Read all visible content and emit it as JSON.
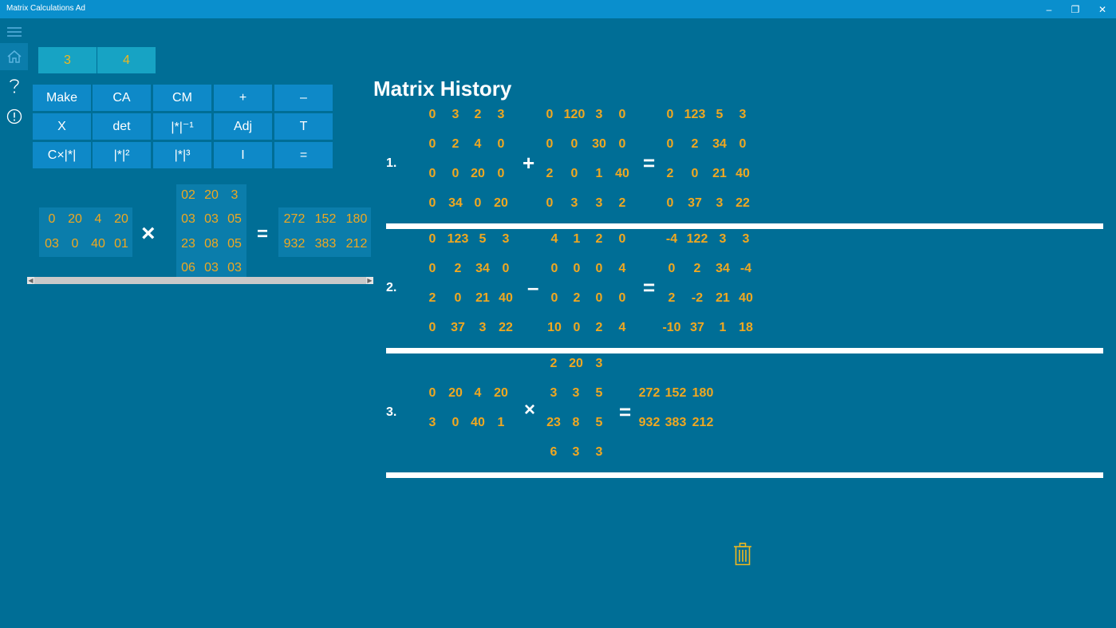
{
  "window": {
    "title": "Matrix Calculations Ad",
    "controls": [
      "–",
      "❐",
      "✕"
    ]
  },
  "sidebar": {
    "icons": [
      "hamburger-icon",
      "home-icon",
      "help-icon",
      "info-icon"
    ]
  },
  "dimensions": {
    "rows": "3",
    "cols": "4"
  },
  "keypad": [
    [
      "Make",
      "CA",
      "CM",
      "+",
      "–"
    ],
    [
      "X",
      "det",
      "|*|⁻¹",
      "Adj",
      "T"
    ],
    [
      "C×|*|",
      "|*|²",
      "|*|³",
      "I",
      "="
    ]
  ],
  "editor": {
    "matrix_a": [
      [
        "0",
        "20",
        "4",
        "20"
      ],
      [
        "03",
        "0",
        "40",
        "01"
      ]
    ],
    "operator": "×",
    "matrix_b": [
      [
        "02",
        "20",
        "3"
      ],
      [
        "03",
        "03",
        "05"
      ],
      [
        "23",
        "08",
        "05"
      ],
      [
        "06",
        "03",
        "03"
      ]
    ],
    "equals": "=",
    "result": [
      [
        "272",
        "152",
        "180"
      ],
      [
        "932",
        "383",
        "212"
      ]
    ]
  },
  "history": {
    "title": "Matrix History",
    "entries": [
      {
        "number": "1.",
        "a": [
          [
            "0",
            "3",
            "2",
            "3"
          ],
          [
            "0",
            "2",
            "4",
            "0"
          ],
          [
            "0",
            "0",
            "20",
            "0"
          ],
          [
            "0",
            "34",
            "0",
            "20"
          ]
        ],
        "op": "+",
        "b": [
          [
            "0",
            "120",
            "3",
            "0"
          ],
          [
            "0",
            "0",
            "30",
            "0"
          ],
          [
            "2",
            "0",
            "1",
            "40"
          ],
          [
            "0",
            "3",
            "3",
            "2"
          ]
        ],
        "eq": "=",
        "r": [
          [
            "0",
            "123",
            "5",
            "3"
          ],
          [
            "0",
            "2",
            "34",
            "0"
          ],
          [
            "2",
            "0",
            "21",
            "40"
          ],
          [
            "0",
            "37",
            "3",
            "22"
          ]
        ]
      },
      {
        "number": "2.",
        "a": [
          [
            "0",
            "123",
            "5",
            "3"
          ],
          [
            "0",
            "2",
            "34",
            "0"
          ],
          [
            "2",
            "0",
            "21",
            "40"
          ],
          [
            "0",
            "37",
            "3",
            "22"
          ]
        ],
        "op": "–",
        "b": [
          [
            "4",
            "1",
            "2",
            "0"
          ],
          [
            "0",
            "0",
            "0",
            "4"
          ],
          [
            "0",
            "2",
            "0",
            "0"
          ],
          [
            "10",
            "0",
            "2",
            "4"
          ]
        ],
        "eq": "=",
        "r": [
          [
            "-4",
            "122",
            "3",
            "3"
          ],
          [
            "0",
            "2",
            "34",
            "-4"
          ],
          [
            "2",
            "-2",
            "21",
            "40"
          ],
          [
            "-10",
            "37",
            "1",
            "18"
          ]
        ]
      },
      {
        "number": "3.",
        "a": [
          [
            "0",
            "20",
            "4",
            "20"
          ],
          [
            "3",
            "0",
            "40",
            "1"
          ]
        ],
        "op": "×",
        "b": [
          [
            "2",
            "20",
            "3"
          ],
          [
            "3",
            "3",
            "5"
          ],
          [
            "23",
            "8",
            "5"
          ],
          [
            "6",
            "3",
            "3"
          ]
        ],
        "eq": "=",
        "r": [
          [
            "272",
            "152",
            "180"
          ],
          [
            "932",
            "383",
            "212"
          ]
        ]
      }
    ]
  },
  "colors": {
    "background": "#006e96",
    "titlebar": "#0a8fcd",
    "key": "#0e89c8",
    "dim_box": "#17a3c4",
    "matrix_box": "#0b7dab",
    "value": "#f0a820"
  }
}
